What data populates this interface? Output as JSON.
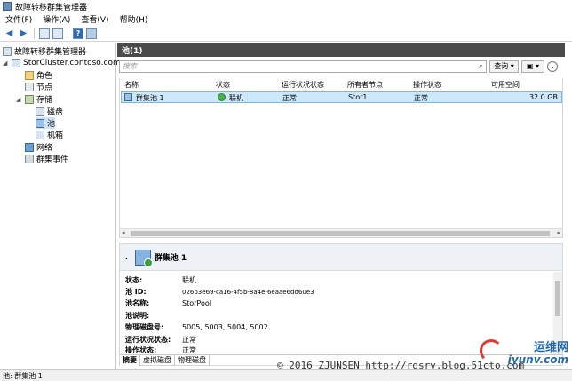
{
  "window": {
    "title": "故障转移群集管理器"
  },
  "menu": [
    "文件(F)",
    "操作(A)",
    "查看(V)",
    "帮助(H)"
  ],
  "tree": {
    "root": "故障转移群集管理器",
    "cluster": "StorCluster.contoso.com",
    "roles": "角色",
    "nodes": "节点",
    "storage": "存储",
    "disks": "磁盘",
    "pools": "池",
    "enclosures": "机箱",
    "networks": "网络",
    "events": "群集事件"
  },
  "pane": {
    "title": "池(1)",
    "search_placeholder": "搜索",
    "query_label": "查询",
    "save_label": "▾"
  },
  "columns": [
    "名称",
    "状态",
    "运行状况状态",
    "所有者节点",
    "操作状态",
    "可用空间"
  ],
  "rows": [
    {
      "name": "群集池 1",
      "status": "联机",
      "health": "正常",
      "owner": "Stor1",
      "op": "正常",
      "free": "32.0 GB"
    }
  ],
  "detail": {
    "title": "群集池 1",
    "props": [
      {
        "k": "状态:",
        "v": "联机"
      },
      {
        "k": "池 ID:",
        "v": "026b3e69-ca16-4f5b-8a4e-6eaae6dd60e3"
      },
      {
        "k": "池名称:",
        "v": "StorPool"
      },
      {
        "k": "池说明:",
        "v": ""
      },
      {
        "k": "物理磁盘号:",
        "v": "5005, 5003, 5004, 5002"
      },
      {
        "k": "运行状况状态:",
        "v": "正常"
      },
      {
        "k": "操作状态:",
        "v": "正常"
      }
    ],
    "tabs": [
      "摘要",
      "虚拟磁盘",
      "物理磁盘"
    ]
  },
  "status_bar": "池: 群集池 1",
  "watermark": "© 2016 ZJUNSEN http://rdsrv.blog.51cto.com",
  "logo": {
    "top": "运维网",
    "bottom": "iyunv.com"
  }
}
